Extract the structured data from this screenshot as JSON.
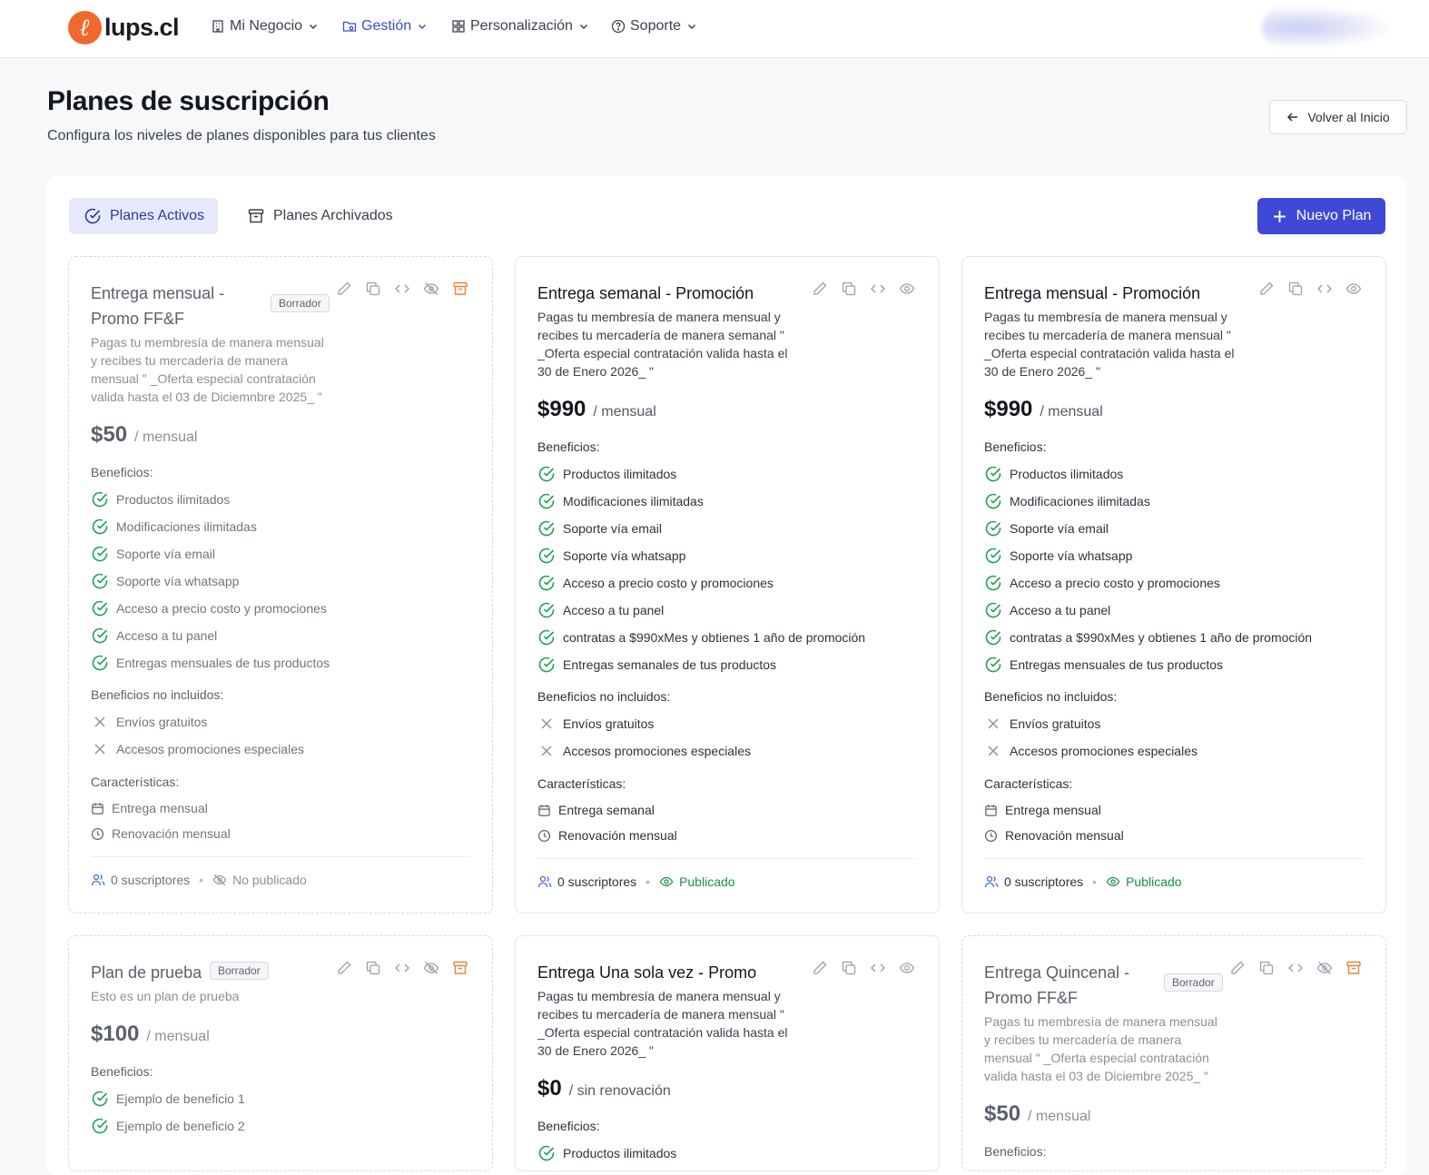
{
  "nav": {
    "logo_letter": "ℓ",
    "logo_text": "lups.cl",
    "items": [
      {
        "label": "Mi Negocio",
        "icon": "building-icon"
      },
      {
        "label": "Gestión",
        "icon": "folder-icon"
      },
      {
        "label": "Personalización",
        "icon": "grid-icon"
      },
      {
        "label": "Soporte",
        "icon": "help-circle-icon"
      }
    ],
    "active": "Gestión"
  },
  "header": {
    "title": "Planes de suscripción",
    "subtitle": "Configura los niveles de planes disponibles para tus clientes",
    "back_label": "Volver al Inicio"
  },
  "tabs": {
    "active_label": "Planes Activos",
    "archived_label": "Planes Archivados",
    "new_plan_label": "Nuevo Plan"
  },
  "colors": {
    "accent": "#4048d6",
    "check": "#22a055",
    "published": "#1f8f4a",
    "archive_icon": "#e8833a",
    "logo": "#ee6a2c"
  },
  "labels": {
    "benefits": "Beneficios:",
    "not_included": "Beneficios no incluidos:",
    "features": "Características:",
    "draft_badge": "Borrador"
  },
  "plans": [
    {
      "title_line1": "Entrega mensual -",
      "title_line2": "Promo FF&F",
      "draft": true,
      "desc": [
        "Pagas tu membresía de manera mensual",
        "y recibes tu mercadería de manera",
        "mensual \" _Oferta especial contratación",
        "valida hasta el 03 de Diciemnbre 2025_ \""
      ],
      "price": "$50",
      "period": "/ mensual",
      "benefits": [
        "Productos ilimitados",
        "Modificaciones ilimitadas",
        "Soporte vía email",
        "Soporte vía whatsapp",
        "Acceso a precio costo y promociones",
        "Acceso a tu panel",
        "Entregas mensuales de tus productos"
      ],
      "not_included": [
        "Envíos gratuitos",
        "Accesos promociones especiales"
      ],
      "features": [
        "Entrega mensual",
        "Renovación mensual"
      ],
      "subscribers": "0 suscriptores",
      "status": "No publicado"
    },
    {
      "title_line1": "Entrega semanal - Promoción",
      "draft": false,
      "desc": [
        "Pagas tu membresía de manera mensual y",
        "recibes tu mercadería de manera semanal \"",
        "_Oferta especial contratación valida hasta el",
        "30 de Enero 2026_ \""
      ],
      "price": "$990",
      "period": "/ mensual",
      "benefits": [
        "Productos ilimitados",
        "Modificaciones ilimitadas",
        "Soporte vía email",
        "Soporte vía whatsapp",
        "Acceso a precio costo y promociones",
        "Acceso a tu panel",
        "contratas a $990xMes y obtienes 1 año de promoción",
        "Entregas semanales de tus productos"
      ],
      "not_included": [
        "Envíos gratuitos",
        "Accesos promociones especiales"
      ],
      "features": [
        "Entrega semanal",
        "Renovación mensual"
      ],
      "subscribers": "0 suscriptores",
      "status": "Publicado"
    },
    {
      "title_line1": "Entrega mensual - Promoción",
      "draft": false,
      "desc": [
        "Pagas tu membresía de manera mensual y",
        "recibes tu mercadería de manera mensual \"",
        "_Oferta especial contratación valida hasta el",
        "30 de Enero 2026_ \""
      ],
      "price": "$990",
      "period": "/ mensual",
      "benefits": [
        "Productos ilimitados",
        "Modificaciones ilimitadas",
        "Soporte vía email",
        "Soporte vía whatsapp",
        "Acceso a precio costo y promociones",
        "Acceso a tu panel",
        "contratas a $990xMes y obtienes 1 año de promoción",
        "Entregas mensuales de tus productos"
      ],
      "not_included": [
        "Envíos gratuitos",
        "Accesos promociones especiales"
      ],
      "features": [
        "Entrega mensual",
        "Renovación mensual"
      ],
      "subscribers": "0 suscriptores",
      "status": "Publicado"
    },
    {
      "title_line1": "Plan de prueba",
      "draft": true,
      "desc": [
        "Esto es un plan de prueba"
      ],
      "price": "$100",
      "period": "/ mensual",
      "benefits": [
        "Ejemplo de beneficio 1",
        "Ejemplo de beneficio 2"
      ]
    },
    {
      "title_line1": "Entrega Una sola vez - Promo",
      "draft": false,
      "desc": [
        "Pagas tu membresía de manera mensual y",
        "recibes tu mercadería de manera mensual \"",
        "_Oferta especial contratación valida hasta el",
        "30 de Enero 2026_ \""
      ],
      "price": "$0",
      "period": "/ sin renovación",
      "benefits": [
        "Productos ilimitados"
      ]
    },
    {
      "title_line1": "Entrega Quincenal -",
      "title_line2": "Promo FF&F",
      "draft": true,
      "desc": [
        "Pagas tu membresía de manera mensual",
        "y recibes tu mercadería de manera",
        "mensual \" _Oferta especial contratación",
        "valida hasta el 03 de Diciembre 2025_ \""
      ],
      "price": "$50",
      "period": "/ mensual"
    }
  ]
}
